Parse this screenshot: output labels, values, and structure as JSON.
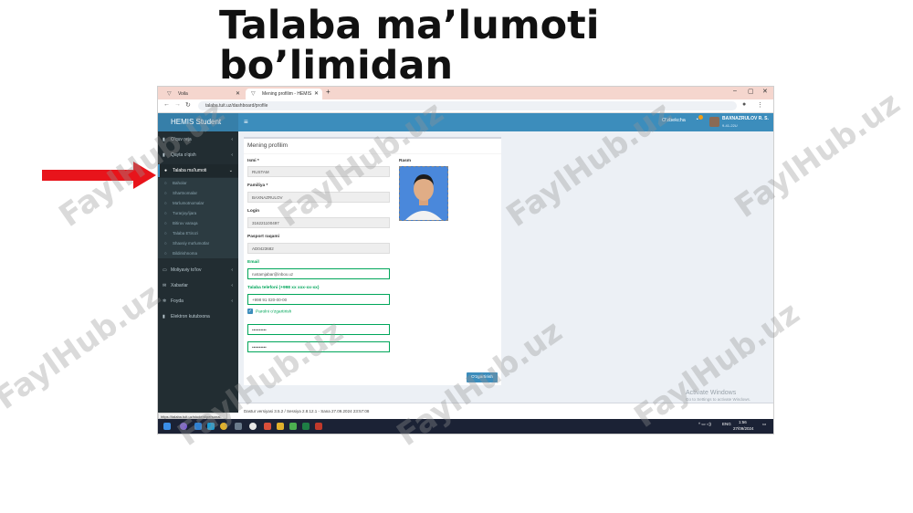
{
  "slide": {
    "title": "Talaba ma’lumoti bo’limidan"
  },
  "browser": {
    "tab1_label": "Voila",
    "tab2_label": "Mening profilim - HEMIS Stude",
    "url": "talaba.tuit.uz/dashboard/profile"
  },
  "app": {
    "brand": "HEMIS Student",
    "language": "O'zbekcha",
    "user_name": "BAXNAZRULOV R. S.",
    "user_group": "9-41-22U"
  },
  "sidebar": {
    "items": [
      {
        "label": "O'quv reja",
        "icon": "book-icon"
      },
      {
        "label": "Qayta o'qish",
        "icon": "repeat-icon"
      },
      {
        "label": "Talaba ma'lumoti",
        "icon": "user-icon"
      },
      {
        "label": "Moliyaviy to'lov",
        "icon": "wallet-icon"
      },
      {
        "label": "Xabarlar",
        "icon": "mail-icon"
      },
      {
        "label": "Foyda",
        "icon": "gear-icon"
      },
      {
        "label": "Elektron kutubxona",
        "icon": "book-icon"
      }
    ],
    "subitems": [
      "Baholar",
      "Shartnomalar",
      "Ma'lumotnomalar",
      "Turarjoy/ijara",
      "Bitiruv varaqa",
      "Talaba E'tirozi",
      "Shaxsiy ma'lumotlar",
      "Bildirishnoma"
    ]
  },
  "profile": {
    "box_title": "Mening profilim",
    "name_label": "Ismi *",
    "name_value": "RUSTAM",
    "surname_label": "Familiya *",
    "surname_value": "BAXNAZRULOV",
    "login_label": "Login",
    "login_value": "316221100497",
    "passport_label": "Pasport raqami",
    "passport_value": "AD0423682",
    "photo_label": "Rasm",
    "email_label": "Email",
    "email_value": "rustamjabar@inbox.uz",
    "phone_label": "Talaba telefoni (+998 xx xxx-xx-xx)",
    "phone_value": "+998 91 020-00-00",
    "password_checkbox_label": "Parolni o'zgartirish",
    "password_mask": "••••••••••",
    "password_confirm_mask": "••••••••••",
    "save_button": "O'zgartirish"
  },
  "watermark": {
    "line1": "Activate Windows",
    "line2": "Go to Settings to activate Windows."
  },
  "footer": {
    "text": "Dastur versiyasi 3.5.2 / Sessiya 2.8.12.1 - Sana 27.09.2024 23:57:08"
  },
  "statusbar": {
    "url": "https://talaba.tuit.uz/student/personal-data"
  },
  "taskbar": {
    "tray_lang": "ENG",
    "time": "1:56",
    "date": "27/09/2024"
  },
  "overlay": {
    "watermark_text": "FaylHub.uz"
  },
  "colors": {
    "accent": "#3c8dbc",
    "sidebar": "#222d32",
    "arrow": "#e8141b",
    "valid": "#00a65a"
  }
}
